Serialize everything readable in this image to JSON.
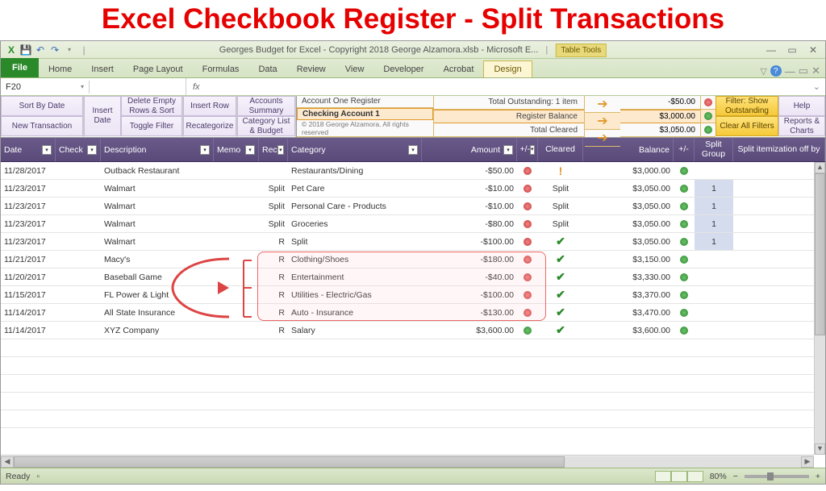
{
  "page_title": "Excel Checkbook Register - Split Transactions",
  "window_title": "Georges Budget for Excel - Copyright 2018 George Alzamora.xlsb  -  Microsoft E...",
  "table_tools": "Table Tools",
  "ribbon": {
    "file": "File",
    "tabs": [
      "Home",
      "Insert",
      "Page Layout",
      "Formulas",
      "Data",
      "Review",
      "View",
      "Developer",
      "Acrobat",
      "Design"
    ]
  },
  "name_box": "F20",
  "fx": "fx",
  "toolbar": {
    "sort_by_date": "Sort By Date",
    "new_transaction": "New Transaction",
    "insert_date": "Insert Date",
    "delete_empty_rows": "Delete Empty Rows & Sort",
    "toggle_filter": "Toggle Filter",
    "insert_row": "Insert Row",
    "recategorize": "Recategorize",
    "accounts_summary": "Accounts Summary",
    "category_list": "Category List & Budget",
    "filter_show": "Filter: Show Outstanding",
    "clear_filters": "Clear All Filters",
    "help": "Help",
    "reports": "Reports & Charts"
  },
  "account": {
    "register_label": "Account One Register",
    "account_name": "Checking Account 1",
    "copyright": "© 2018 George Alzamora. All rights reserved",
    "total_outstanding_label": "Total Outstanding: 1 item",
    "register_balance_label": "Register Balance",
    "total_cleared_label": "Total Cleared",
    "total_outstanding_value": "-$50.00",
    "register_balance_value": "$3,000.00",
    "total_cleared_value": "$3,050.00"
  },
  "columns": {
    "date": "Date",
    "check": "Check",
    "description": "Description",
    "memo": "Memo",
    "rec": "Rec",
    "category": "Category",
    "amount": "Amount",
    "pm1": "+/-",
    "cleared": "Cleared",
    "balance": "Balance",
    "pm2": "+/-",
    "split_group": "Split Group",
    "split_off": "Split itemization off by"
  },
  "rows": [
    {
      "date": "11/14/2017",
      "desc": "XYZ Company",
      "rec": "R",
      "cat": "Salary",
      "amt": "$3,600.00",
      "amt_pos": true,
      "cleared": "check",
      "bal": "$3,600.00",
      "sg": ""
    },
    {
      "date": "11/14/2017",
      "desc": "All State Insurance",
      "rec": "R",
      "cat": "Auto - Insurance",
      "amt": "-$130.00",
      "amt_pos": false,
      "cleared": "check",
      "bal": "$3,470.00",
      "sg": ""
    },
    {
      "date": "11/15/2017",
      "desc": "FL Power & Light",
      "rec": "R",
      "cat": "Utilities - Electric/Gas",
      "amt": "-$100.00",
      "amt_pos": false,
      "cleared": "check",
      "bal": "$3,370.00",
      "sg": ""
    },
    {
      "date": "11/20/2017",
      "desc": "Baseball Game",
      "rec": "R",
      "cat": "Entertainment",
      "amt": "-$40.00",
      "amt_pos": false,
      "cleared": "check",
      "bal": "$3,330.00",
      "sg": ""
    },
    {
      "date": "11/21/2017",
      "desc": "Macy's",
      "rec": "R",
      "cat": "Clothing/Shoes",
      "amt": "-$180.00",
      "amt_pos": false,
      "cleared": "check",
      "bal": "$3,150.00",
      "sg": ""
    },
    {
      "date": "11/23/2017",
      "desc": "Walmart",
      "rec": "R",
      "cat": "Split",
      "amt": "-$100.00",
      "amt_pos": false,
      "cleared": "check",
      "bal": "$3,050.00",
      "sg": "1",
      "sg_hl": true
    },
    {
      "date": "11/23/2017",
      "desc": "Walmart",
      "rec": "Split",
      "cat": "Groceries",
      "amt": "-$80.00",
      "amt_pos": false,
      "cleared": "Split",
      "bal": "$3,050.00",
      "sg": "1",
      "sg_hl": true
    },
    {
      "date": "11/23/2017",
      "desc": "Walmart",
      "rec": "Split",
      "cat": "Personal Care - Products",
      "amt": "-$10.00",
      "amt_pos": false,
      "cleared": "Split",
      "bal": "$3,050.00",
      "sg": "1",
      "sg_hl": true
    },
    {
      "date": "11/23/2017",
      "desc": "Walmart",
      "rec": "Split",
      "cat": "Pet Care",
      "amt": "-$10.00",
      "amt_pos": false,
      "cleared": "Split",
      "bal": "$3,050.00",
      "sg": "1",
      "sg_hl": true
    },
    {
      "date": "11/28/2017",
      "desc": "Outback Restaurant",
      "rec": "",
      "cat": "Restaurants/Dining",
      "amt": "-$50.00",
      "amt_pos": false,
      "cleared": "pending",
      "bal": "$3,000.00",
      "sg": ""
    }
  ],
  "status": {
    "ready": "Ready",
    "zoom": "80%"
  }
}
